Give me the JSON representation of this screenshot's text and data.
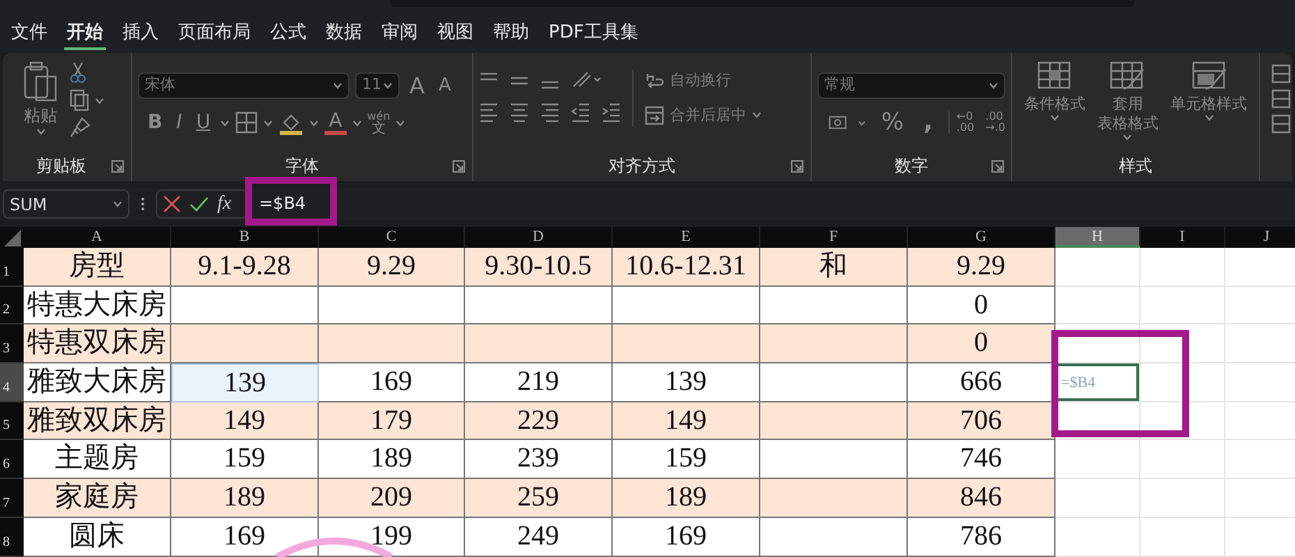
{
  "menu_tabs": [
    {
      "label": "文件",
      "selected": false
    },
    {
      "label": "开始",
      "selected": true
    },
    {
      "label": "插入",
      "selected": false
    },
    {
      "label": "页面布局",
      "selected": false
    },
    {
      "label": "公式",
      "selected": false
    },
    {
      "label": "数据",
      "selected": false
    },
    {
      "label": "审阅",
      "selected": false
    },
    {
      "label": "视图",
      "selected": false
    },
    {
      "label": "帮助",
      "selected": false
    },
    {
      "label": "PDF工具集",
      "selected": false
    }
  ],
  "ribbon": {
    "clipboard": {
      "paste": "粘贴",
      "title": "剪贴板"
    },
    "font": {
      "font_name": "宋体",
      "font_size": "11",
      "grow": "A",
      "shrink": "A",
      "bold": "B",
      "italic": "I",
      "underline": "U",
      "font_color": "A",
      "phonetic_top": "wén",
      "phonetic_bottom": "文",
      "title": "字体"
    },
    "alignment": {
      "wrap_text": "自动换行",
      "merge_center": "合并后居中",
      "title": "对齐方式"
    },
    "number": {
      "format": "常规",
      "percent": "%",
      "comma": ",",
      "increase_top": "←0",
      "increase_bottom": ".00",
      "decrease_top": ".00",
      "decrease_bottom": "→.0",
      "title": "数字"
    },
    "styles": {
      "items": [
        {
          "lines": [
            "条件格式"
          ]
        },
        {
          "lines": [
            "套用",
            "表格格式"
          ]
        },
        {
          "lines": [
            "单元格样式"
          ]
        }
      ],
      "title": "样式"
    }
  },
  "formula_bar": {
    "name_box": "SUM",
    "fx": "fx",
    "formula": "=$B4"
  },
  "sheet": {
    "columns": [
      {
        "label": "A",
        "selected": false
      },
      {
        "label": "B",
        "selected": false
      },
      {
        "label": "C",
        "selected": false
      },
      {
        "label": "D",
        "selected": false
      },
      {
        "label": "E",
        "selected": false
      },
      {
        "label": "F",
        "selected": false
      },
      {
        "label": "G",
        "selected": false
      },
      {
        "label": "H",
        "selected": true
      },
      {
        "label": "I",
        "selected": false
      },
      {
        "label": "J",
        "selected": false
      }
    ],
    "rows": [
      {
        "number": "1",
        "selected": false,
        "shaded": true,
        "cells": [
          {
            "text": "房型",
            "referenced": false
          },
          {
            "text": "9.1-9.28",
            "referenced": false
          },
          {
            "text": "9.29",
            "referenced": false
          },
          {
            "text": "9.30-10.5",
            "referenced": false
          },
          {
            "text": "10.6-12.31",
            "referenced": false
          },
          {
            "text": "和",
            "referenced": false
          },
          {
            "text": "9.29",
            "referenced": false
          }
        ]
      },
      {
        "number": "2",
        "selected": false,
        "shaded": false,
        "cells": [
          {
            "text": "特惠大床房",
            "referenced": false
          },
          {
            "referenced": false
          },
          {
            "referenced": false
          },
          {
            "referenced": false
          },
          {
            "referenced": false
          },
          {
            "referenced": false
          },
          {
            "text": "0",
            "referenced": false
          }
        ]
      },
      {
        "number": "3",
        "selected": false,
        "shaded": true,
        "cells": [
          {
            "text": "特惠双床房",
            "referenced": false
          },
          {
            "referenced": false
          },
          {
            "referenced": false
          },
          {
            "referenced": false
          },
          {
            "referenced": false
          },
          {
            "referenced": false
          },
          {
            "text": "0",
            "referenced": false
          }
        ]
      },
      {
        "number": "4",
        "selected": true,
        "shaded": false,
        "editing": "=$B4",
        "cells": [
          {
            "text": "雅致大床房",
            "referenced": false
          },
          {
            "text": "139",
            "referenced": true
          },
          {
            "text": "169",
            "referenced": false
          },
          {
            "text": "219",
            "referenced": false
          },
          {
            "text": "139",
            "referenced": false
          },
          {
            "referenced": false
          },
          {
            "text": "666",
            "referenced": false
          }
        ]
      },
      {
        "number": "5",
        "selected": false,
        "shaded": true,
        "cells": [
          {
            "text": "雅致双床房",
            "referenced": false
          },
          {
            "text": "149",
            "referenced": false
          },
          {
            "text": "179",
            "referenced": false
          },
          {
            "text": "229",
            "referenced": false
          },
          {
            "text": "149",
            "referenced": false
          },
          {
            "referenced": false
          },
          {
            "text": "706",
            "referenced": false
          }
        ]
      },
      {
        "number": "6",
        "selected": false,
        "shaded": false,
        "cells": [
          {
            "text": "主题房",
            "referenced": false
          },
          {
            "text": "159",
            "referenced": false
          },
          {
            "text": "189",
            "referenced": false
          },
          {
            "text": "239",
            "referenced": false
          },
          {
            "text": "159",
            "referenced": false
          },
          {
            "referenced": false
          },
          {
            "text": "746",
            "referenced": false
          }
        ]
      },
      {
        "number": "7",
        "selected": false,
        "shaded": true,
        "cells": [
          {
            "text": "家庭房",
            "referenced": false
          },
          {
            "text": "189",
            "referenced": false
          },
          {
            "text": "209",
            "referenced": false
          },
          {
            "text": "259",
            "referenced": false
          },
          {
            "text": "189",
            "referenced": false
          },
          {
            "referenced": false
          },
          {
            "text": "846",
            "referenced": false
          }
        ]
      },
      {
        "number": "8",
        "selected": false,
        "shaded": false,
        "cells": [
          {
            "text": "圆床",
            "referenced": false
          },
          {
            "text": "169",
            "referenced": false
          },
          {
            "text": "199",
            "referenced": false
          },
          {
            "text": "249",
            "referenced": false
          },
          {
            "text": "169",
            "referenced": false
          },
          {
            "referenced": false
          },
          {
            "text": "786",
            "referenced": false
          }
        ]
      }
    ]
  }
}
